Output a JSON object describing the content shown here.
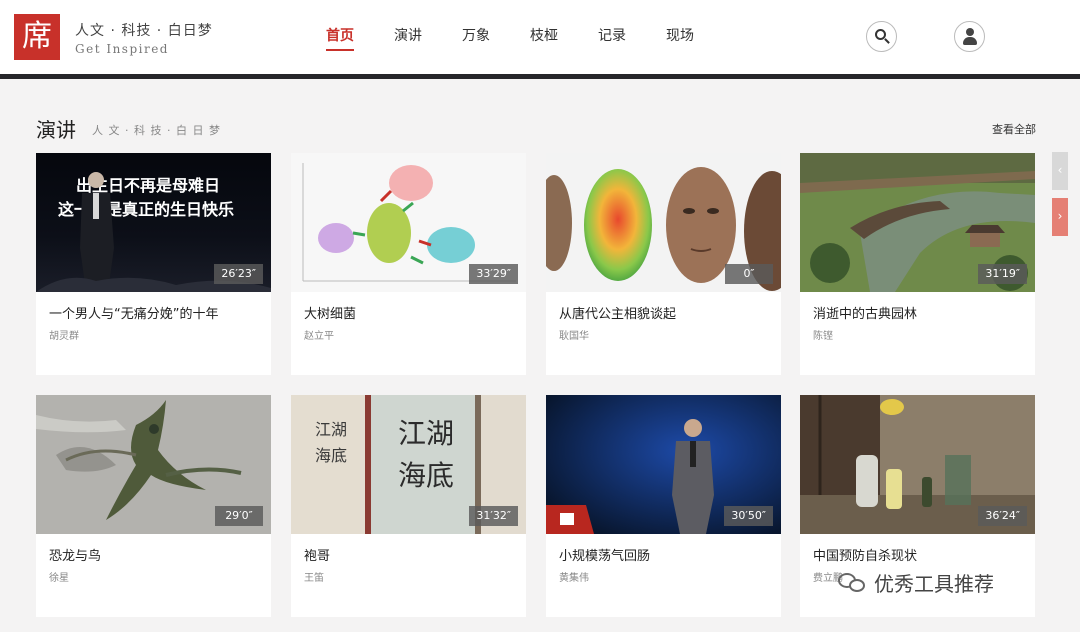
{
  "brand": {
    "logo_char": "席",
    "title": "人文 · 科技 · 白日梦",
    "subtitle": "Get Inspired"
  },
  "nav": {
    "items": [
      {
        "label": "首页",
        "active": true
      },
      {
        "label": "演讲",
        "active": false
      },
      {
        "label": "万象",
        "active": false
      },
      {
        "label": "枝桠",
        "active": false
      },
      {
        "label": "记录",
        "active": false
      },
      {
        "label": "现场",
        "active": false
      }
    ]
  },
  "header_icons": {
    "search": "search-icon",
    "user": "user-icon"
  },
  "section": {
    "title": "演讲",
    "subtitle": "人 文 · 科 技 · 白 日 梦",
    "see_all": "查看全部"
  },
  "cards": [
    {
      "title": "一个男人与“无痛分娩”的十年",
      "author": "胡灵群",
      "duration": "26′23″",
      "image_text": "出生日不再是母难日\n这一天是真正的生日快乐"
    },
    {
      "title": "大树细菌",
      "author": "赵立平",
      "duration": "33′29″",
      "image_text": ""
    },
    {
      "title": "从唐代公主相貌谈起",
      "author": "耿国华",
      "duration": "0″",
      "image_text": ""
    },
    {
      "title": "消逝中的古典园林",
      "author": "陈铿",
      "duration": "31′19″",
      "image_text": ""
    },
    {
      "title": "恐龙与鸟",
      "author": "徐星",
      "duration": "29′0″",
      "image_text": ""
    },
    {
      "title": "袍哥",
      "author": "王笛",
      "duration": "31′32″",
      "image_text": "江湖海底"
    },
    {
      "title": "小规模荡气回肠",
      "author": "黄集伟",
      "duration": "30′50″",
      "image_text": ""
    },
    {
      "title": "中国预防自杀现状",
      "author": "费立鹏",
      "duration": "36′24″",
      "image_text": ""
    }
  ],
  "watermark": "优秀工具推荐",
  "colors": {
    "accent": "#c8312a",
    "header_rule": "#26262a",
    "page_bg": "#f4f3f3"
  }
}
